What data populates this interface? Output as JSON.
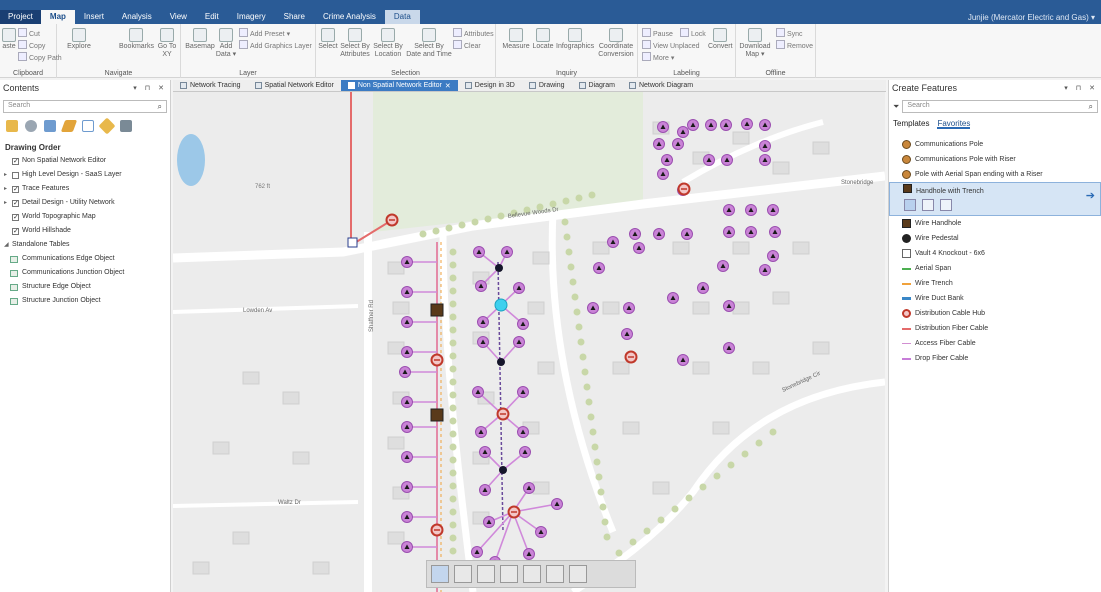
{
  "ribbon_tabs": [
    "Project",
    "Map",
    "Insert",
    "Analysis",
    "View",
    "Edit",
    "Imagery",
    "Share",
    "Crime Analysis",
    "Data"
  ],
  "user_name": "Junjie (Mercator Electric and Gas) ▾",
  "ribbon": {
    "clipboard": {
      "label": "Clipboard",
      "paste": "aste",
      "cut": "Cut",
      "copy": "Copy",
      "copy_path": "Copy Path"
    },
    "navigate": {
      "label": "Navigate",
      "explore": "Explore",
      "bookmarks": "Bookmarks",
      "goto": "Go To XY"
    },
    "layer": {
      "label": "Layer",
      "basemap": "Basemap",
      "add_data": "Add Data ▾",
      "add_preset": "Add Preset ▾",
      "add_graphics": "Add Graphics Layer"
    },
    "selection": {
      "label": "Selection",
      "select": "Select",
      "by_attr": "Select By Attributes",
      "by_loc": "Select By Location",
      "by_date": "Select By Date and Time",
      "attributes": "Attributes",
      "clear": "Clear"
    },
    "inquiry": {
      "label": "Inquiry",
      "measure": "Measure",
      "locate": "Locate",
      "infographics": "Infographics",
      "coord": "Coordinate Conversion"
    },
    "labeling": {
      "label": "Labeling",
      "pause": "Pause",
      "lock": "Lock",
      "view_unplaced": "View Unplaced",
      "more": "More ▾",
      "convert": "Convert"
    },
    "offline": {
      "label": "Offline",
      "download": "Download Map ▾",
      "sync": "Sync",
      "remove": "Remove"
    }
  },
  "contents": {
    "title": "Contents",
    "search_placeholder": "Search",
    "drawing_order": "Drawing Order",
    "layers": [
      {
        "name": "Non Spatial Network Editor",
        "checked": true,
        "arrow": ""
      },
      {
        "name": "High Level Design - SaaS Layer",
        "checked": false,
        "arrow": "▸"
      },
      {
        "name": "Trace Features",
        "checked": true,
        "arrow": "▸"
      },
      {
        "name": "Detail Design - Utility Network",
        "checked": true,
        "arrow": "▸"
      },
      {
        "name": "World Topographic Map",
        "checked": true,
        "arrow": ""
      },
      {
        "name": "World Hillshade",
        "checked": true,
        "arrow": ""
      }
    ],
    "standalone_label": "Standalone Tables",
    "tables": [
      "Communications Edge Object",
      "Communications Junction Object",
      "Structure Edge Object",
      "Structure Junction Object"
    ]
  },
  "map_tabs": [
    "Network Tracing",
    "Spatial Network Editor",
    "Non Spatial Network Editor",
    "Design in 3D",
    "Drawing",
    "Diagram",
    "Network Diagram"
  ],
  "active_map_tab": 2,
  "map_labels": {
    "street1": "Bellevue Woods Dr",
    "street2": "Lowden Av",
    "street3": "Waltz Dr",
    "street4": "Stonebridge Cir",
    "street5": "Shaffner Rd",
    "street6": "Stonebridge",
    "elevation": "762 ft"
  },
  "create_features": {
    "title": "Create Features",
    "search_placeholder": "Search",
    "tabs": [
      "Templates",
      "Favorites"
    ],
    "templates": [
      {
        "name": "Communications Pole",
        "sym": "pole"
      },
      {
        "name": "Communications Pole with Riser",
        "sym": "pole"
      },
      {
        "name": "Pole with Aerial Span ending with a Riser",
        "sym": "pole"
      },
      {
        "name": "Handhole with Trench",
        "sym": "handhole",
        "selected": true
      },
      {
        "name": "Wire Handhole",
        "sym": "handhole"
      },
      {
        "name": "Wire Pedestal",
        "sym": "pedestal"
      },
      {
        "name": "Vault 4 Knockout - 6x6",
        "sym": "vault"
      },
      {
        "name": "Aerial Span",
        "sym": "aerial"
      },
      {
        "name": "Wire Trench",
        "sym": "trench"
      },
      {
        "name": "Wire Duct Bank",
        "sym": "duct"
      },
      {
        "name": "Distribution Cable Hub",
        "sym": "hub"
      },
      {
        "name": "Distribution Fiber Cable",
        "sym": "distfiber"
      },
      {
        "name": "Access Fiber Cable",
        "sym": "access"
      },
      {
        "name": "Drop Fiber Cable",
        "sym": "drop"
      }
    ]
  }
}
